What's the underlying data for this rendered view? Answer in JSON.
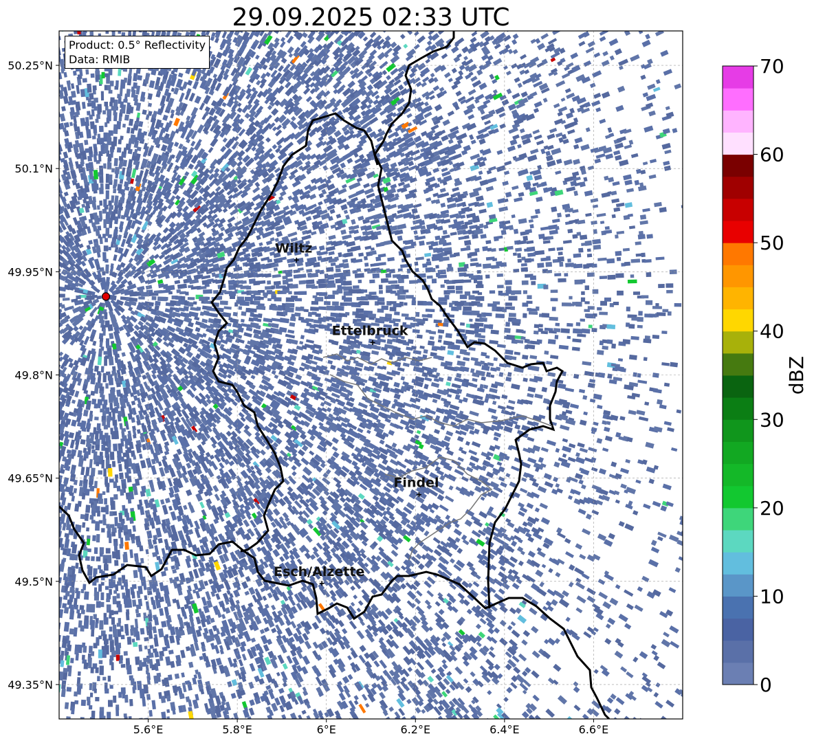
{
  "title": "29.09.2025 02:33 UTC",
  "info": {
    "product": "Product: 0.5° Reflectivity",
    "data": "Data: RMIB"
  },
  "axes": {
    "lon_range": [
      5.4,
      6.8
    ],
    "lat_range": [
      49.3,
      50.3
    ],
    "lon_ticks": [
      {
        "value": 5.6,
        "label": "5.6°E"
      },
      {
        "value": 5.8,
        "label": "5.8°E"
      },
      {
        "value": 6.0,
        "label": "6°E"
      },
      {
        "value": 6.2,
        "label": "6.2°E"
      },
      {
        "value": 6.4,
        "label": "6.4°E"
      },
      {
        "value": 6.6,
        "label": "6.6°E"
      }
    ],
    "lat_ticks": [
      {
        "value": 50.25,
        "label": "50.25°N"
      },
      {
        "value": 50.1,
        "label": "50.1°N"
      },
      {
        "value": 49.95,
        "label": "49.95°N"
      },
      {
        "value": 49.8,
        "label": "49.8°N"
      },
      {
        "value": 49.65,
        "label": "49.65°N"
      },
      {
        "value": 49.5,
        "label": "49.5°N"
      },
      {
        "value": 49.35,
        "label": "49.35°N"
      }
    ]
  },
  "radar_site": {
    "lon": 5.505,
    "lat": 49.914
  },
  "cities": [
    {
      "name": "Wiltz",
      "lon": 5.933,
      "lat": 49.967
    },
    {
      "name": "Ettelbruck",
      "lon": 6.104,
      "lat": 49.847
    },
    {
      "name": "Findel",
      "lon": 6.208,
      "lat": 49.626
    },
    {
      "name": "Esch/Alzette",
      "lon": 5.99,
      "lat": 49.497
    }
  ],
  "colorbar": {
    "unit": "dBZ",
    "min": 0,
    "max": 70,
    "step": 2.5,
    "ticks": [
      {
        "value": 0,
        "label": "0"
      },
      {
        "value": 10,
        "label": "10"
      },
      {
        "value": 20,
        "label": "20"
      },
      {
        "value": 30,
        "label": "30"
      },
      {
        "value": 40,
        "label": "40"
      },
      {
        "value": 50,
        "label": "50"
      },
      {
        "value": 60,
        "label": "60"
      },
      {
        "value": 70,
        "label": "70"
      }
    ],
    "colors": [
      "#6b7fb3",
      "#5a70a8",
      "#4a63a3",
      "#4a72b0",
      "#5a96c8",
      "#62bede",
      "#5cd8c0",
      "#3ed67a",
      "#12c830",
      "#14b828",
      "#12a822",
      "#10961c",
      "#0b7e14",
      "#0a6410",
      "#467a10",
      "#a8b10a",
      "#ffd700",
      "#ffb400",
      "#ff9600",
      "#ff7800",
      "#e80000",
      "#c80000",
      "#a00000",
      "#7a0000",
      "#ffe0ff",
      "#ffb4ff",
      "#ff6eff",
      "#e63ce6"
    ]
  },
  "echo_colors": {
    "base": [
      "#5a70a8",
      "#6176a9",
      "#55699f"
    ],
    "light": [
      "#3ed67a",
      "#5cd8c0",
      "#12c830",
      "#62bede"
    ],
    "strong": [
      "#ffd700",
      "#ff7800",
      "#c80000"
    ]
  }
}
